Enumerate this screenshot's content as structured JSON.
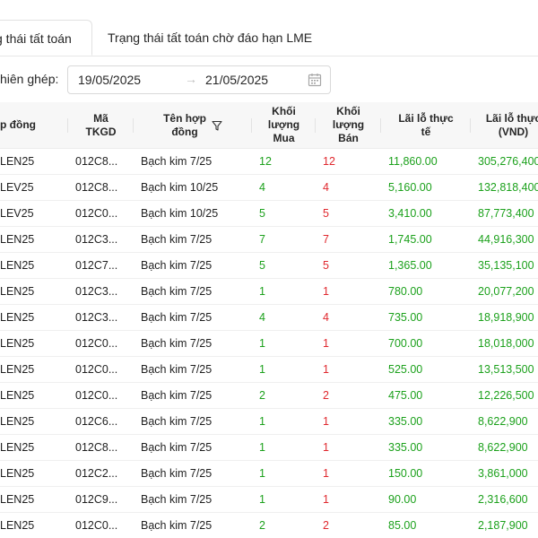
{
  "tabs": [
    {
      "label": "g thái tất toán",
      "active": true
    },
    {
      "label": "Trạng thái tất toán chờ đáo hạn LME",
      "active": false
    }
  ],
  "filter": {
    "label": "hiên ghép:",
    "date_start": "19/05/2025",
    "date_end": "21/05/2025",
    "arrow": "→"
  },
  "table": {
    "headers": {
      "contract": "p đồng",
      "tkgd": "Mã\nTKGD",
      "name": "Tên hợp\nđồng",
      "buy": "Khối\nlượng\nMua",
      "sell": "Khối\nlượng\nBán",
      "pl": "Lãi lỗ thực\ntế",
      "pl_vnd": "Lãi lỗ thực\n(VND)"
    },
    "rows": [
      {
        "contract": "LEN25",
        "tkgd": "012C8...",
        "name": "Bạch kim 7/25",
        "buy": "12",
        "sell": "12",
        "pl": "11,860.00",
        "pl_vnd": "305,276,400"
      },
      {
        "contract": "LEV25",
        "tkgd": "012C8...",
        "name": "Bạch kim 10/25",
        "buy": "4",
        "sell": "4",
        "pl": "5,160.00",
        "pl_vnd": "132,818,400"
      },
      {
        "contract": "LEV25",
        "tkgd": "012C0...",
        "name": "Bạch kim 10/25",
        "buy": "5",
        "sell": "5",
        "pl": "3,410.00",
        "pl_vnd": "87,773,400"
      },
      {
        "contract": "LEN25",
        "tkgd": "012C3...",
        "name": "Bạch kim 7/25",
        "buy": "7",
        "sell": "7",
        "pl": "1,745.00",
        "pl_vnd": "44,916,300"
      },
      {
        "contract": "LEN25",
        "tkgd": "012C7...",
        "name": "Bạch kim 7/25",
        "buy": "5",
        "sell": "5",
        "pl": "1,365.00",
        "pl_vnd": "35,135,100"
      },
      {
        "contract": "LEN25",
        "tkgd": "012C3...",
        "name": "Bạch kim 7/25",
        "buy": "1",
        "sell": "1",
        "pl": "780.00",
        "pl_vnd": "20,077,200"
      },
      {
        "contract": "LEN25",
        "tkgd": "012C3...",
        "name": "Bạch kim 7/25",
        "buy": "4",
        "sell": "4",
        "pl": "735.00",
        "pl_vnd": "18,918,900"
      },
      {
        "contract": "LEN25",
        "tkgd": "012C0...",
        "name": "Bạch kim 7/25",
        "buy": "1",
        "sell": "1",
        "pl": "700.00",
        "pl_vnd": "18,018,000"
      },
      {
        "contract": "LEN25",
        "tkgd": "012C0...",
        "name": "Bạch kim 7/25",
        "buy": "1",
        "sell": "1",
        "pl": "525.00",
        "pl_vnd": "13,513,500"
      },
      {
        "contract": "LEN25",
        "tkgd": "012C0...",
        "name": "Bạch kim 7/25",
        "buy": "2",
        "sell": "2",
        "pl": "475.00",
        "pl_vnd": "12,226,500"
      },
      {
        "contract": "LEN25",
        "tkgd": "012C6...",
        "name": "Bạch kim 7/25",
        "buy": "1",
        "sell": "1",
        "pl": "335.00",
        "pl_vnd": "8,622,900"
      },
      {
        "contract": "LEN25",
        "tkgd": "012C8...",
        "name": "Bạch kim 7/25",
        "buy": "1",
        "sell": "1",
        "pl": "335.00",
        "pl_vnd": "8,622,900"
      },
      {
        "contract": "LEN25",
        "tkgd": "012C2...",
        "name": "Bạch kim 7/25",
        "buy": "1",
        "sell": "1",
        "pl": "150.00",
        "pl_vnd": "3,861,000"
      },
      {
        "contract": "LEN25",
        "tkgd": "012C9...",
        "name": "Bạch kim 7/25",
        "buy": "1",
        "sell": "1",
        "pl": "90.00",
        "pl_vnd": "2,316,600"
      },
      {
        "contract": "LEN25",
        "tkgd": "012C0...",
        "name": "Bạch kim 7/25",
        "buy": "2",
        "sell": "2",
        "pl": "85.00",
        "pl_vnd": "2,187,900"
      }
    ]
  },
  "colors": {
    "buy": "#1ca11c",
    "sell": "#e0282e",
    "profit": "#1ca11c"
  },
  "icons": {
    "date_picker": "calendar-icon",
    "column_filter": "filter-icon"
  }
}
